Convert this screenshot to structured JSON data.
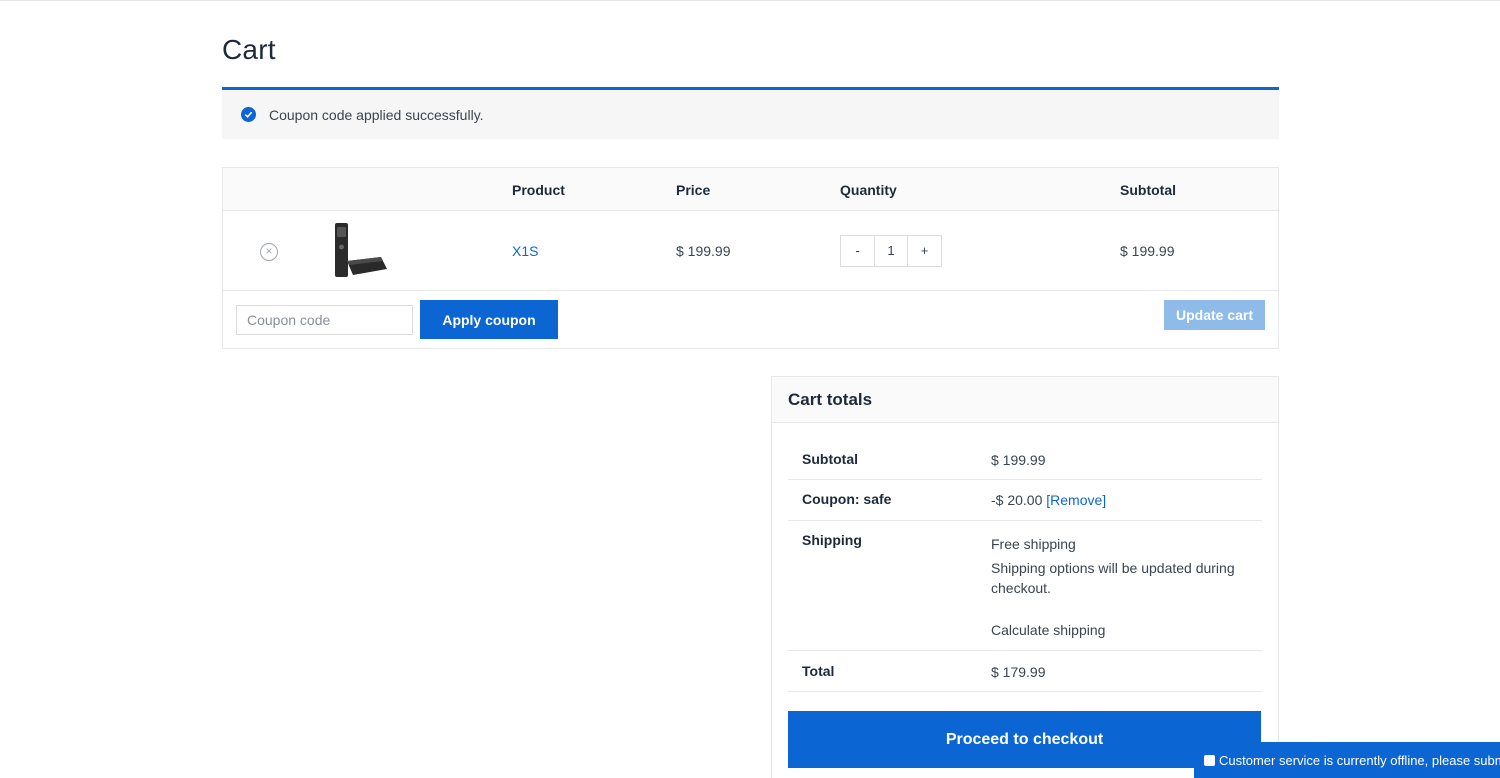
{
  "page": {
    "title": "Cart"
  },
  "notice": {
    "message": "Coupon code applied successfully.",
    "icon": "check-circle-icon"
  },
  "table": {
    "headers": {
      "product": "Product",
      "price": "Price",
      "quantity": "Quantity",
      "subtotal": "Subtotal"
    },
    "rows": [
      {
        "remove_icon": "×",
        "product": "X1S",
        "price": "$ 199.99",
        "quantity": "1",
        "subtotal": "$ 199.99",
        "qty_minus": "-",
        "qty_plus": "+"
      }
    ]
  },
  "actions": {
    "coupon_placeholder": "Coupon code",
    "apply_label": "Apply coupon",
    "update_label": "Update cart"
  },
  "totals": {
    "title": "Cart totals",
    "subtotal_label": "Subtotal",
    "subtotal_value": "$ 199.99",
    "coupon_label": "Coupon: safe",
    "coupon_value": "-$ 20.00",
    "coupon_remove": "[Remove]",
    "shipping_label": "Shipping",
    "shipping_method": "Free shipping",
    "shipping_note": "Shipping options will be updated during checkout.",
    "calculate_shipping": "Calculate shipping",
    "total_label": "Total",
    "total_value": "$ 179.99",
    "checkout_label": "Proceed to checkout"
  },
  "chat": {
    "text": "Customer service is currently offline, please submit a ticket"
  },
  "colors": {
    "accent": "#0b66d3",
    "disabled_button": "#8fbbe9"
  }
}
